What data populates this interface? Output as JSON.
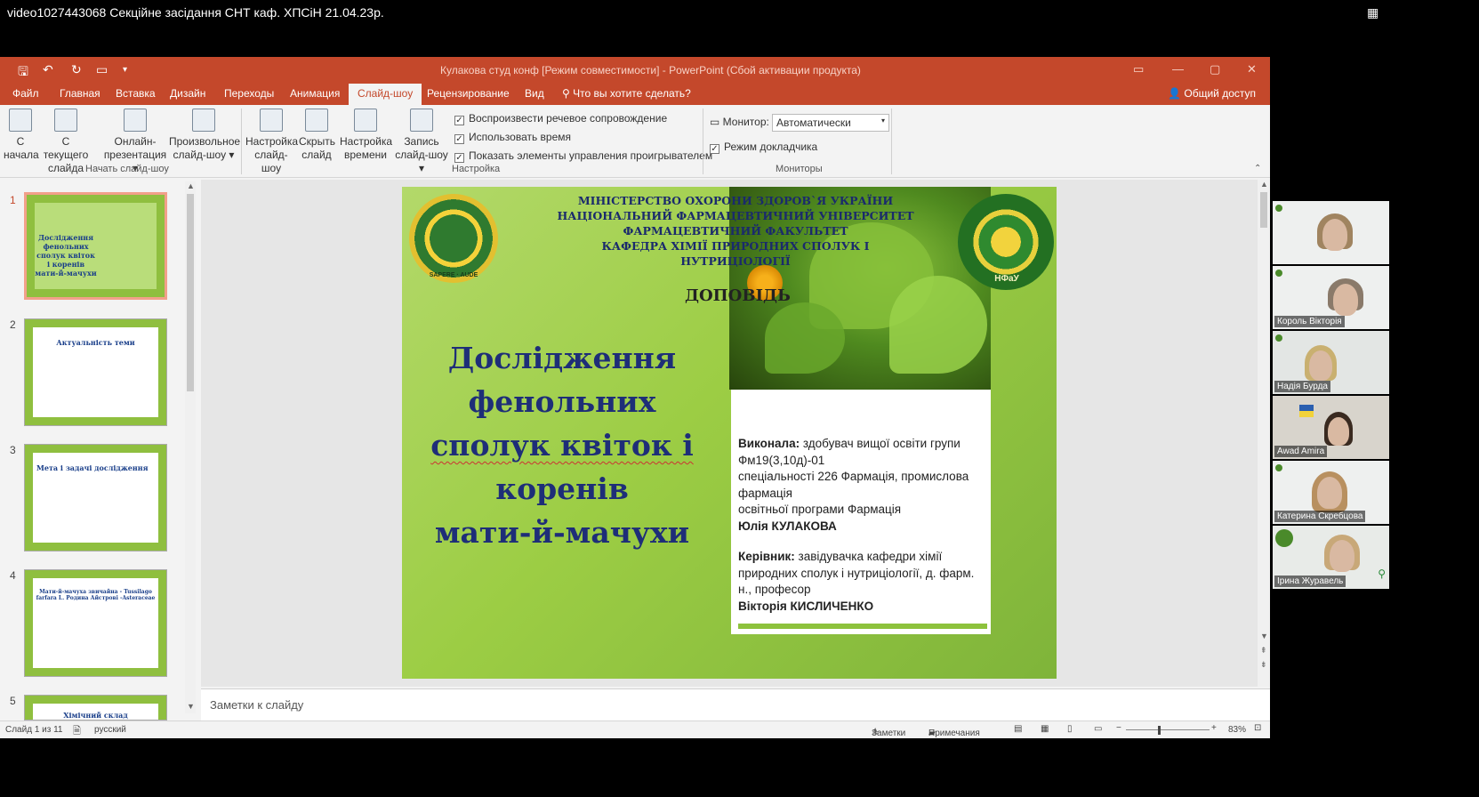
{
  "video_title": "video1027443068 Секційне засідання СНТ каф. ХПСіН 21.04.23р.",
  "window_title": "Кулакова студ конф [Режим совместимости] - PowerPoint (Сбой активации продукта)",
  "tabs": [
    "Файл",
    "Главная",
    "Вставка",
    "Дизайн",
    "Переходы",
    "Анимация",
    "Слайд-шоу",
    "Рецензирование",
    "Вид"
  ],
  "active_tab": "Слайд-шоу",
  "tell_me": "Что вы хотите сделать?",
  "share": "Общий доступ",
  "ribbon": {
    "from_start": [
      "С",
      "начала"
    ],
    "from_current": [
      "С текущего",
      "слайда"
    ],
    "online": [
      "Онлайн-",
      "презентация ▾"
    ],
    "custom": [
      "Произвольное",
      "слайд-шоу ▾"
    ],
    "group_start": "Начать слайд-шоу",
    "setup": [
      "Настройка",
      "слайд-шоу"
    ],
    "hide": [
      "Скрыть",
      "слайд"
    ],
    "rehearse": [
      "Настройка",
      "времени"
    ],
    "record": [
      "Запись",
      "слайд-шоу ▾"
    ],
    "chk_narration": "Воспроизвести речевое сопровождение",
    "chk_timings": "Использовать время",
    "chk_controls": "Показать элементы управления проигрывателем",
    "group_setup": "Настройка",
    "monitor_label": "Монитор:",
    "monitor_value": "Автоматически",
    "presenter_view": "Режим докладчика",
    "group_monitors": "Мониторы"
  },
  "thumbnails": [
    {
      "num": "1",
      "title": "Дослідження фенольних сполук квіток і коренів мати-й-мачухи"
    },
    {
      "num": "2",
      "title": "Актуальність теми"
    },
    {
      "num": "3",
      "title": "Мета і задачі дослідження"
    },
    {
      "num": "4",
      "title": "Мати-й-мачуха звичайна - Tussilago farfara L. Родина Айстрові -Asteraceae"
    },
    {
      "num": "5",
      "title": "Хімічний склад"
    }
  ],
  "slide": {
    "header": [
      "МІНІСТЕРСТВО ОХОРОНИ ЗДОРОВ`Я УКРАЇНИ",
      "НАЦІОНАЛЬНИЙ ФАРМАЦЕВТИЧНИЙ УНІВЕРСИТЕТ",
      "ФАРМАЦЕВТИЧНИЙ ФАКУЛЬТЕТ",
      "КАФЕДРА ХІМІЇ ПРИРОДНИХ СПОЛУК І НУТРИЦІОЛОГІЇ"
    ],
    "report_label": "ДОПОВІДЬ",
    "title": [
      "Дослідження",
      "фенольних",
      "сполук квіток і",
      "коренів",
      "мати-й-мачухи"
    ],
    "logo_left_text": "SAPERE · AUDE",
    "logo_right_text": "НФаУ",
    "performed_label": "Виконала:",
    "performed_text": " здобувач вищої освіти групи Фм19(3,10д)-01",
    "specialty": "спеціальності 226 Фармація, промислова фармація",
    "program": "освітньої програми Фармація",
    "student": "Юлія КУЛАКОВА",
    "supervisor_label": "Керівник:",
    "supervisor_text": " завідувачка кафедри хімії природних сполук і нутриціології, д. фарм. н., професор",
    "supervisor_name": "Вікторія КИСЛИЧЕНКО"
  },
  "notes_placeholder": "Заметки к слайду",
  "status": {
    "slide_count": "Слайд 1 из 11",
    "language": "русский",
    "notes": "Заметки",
    "comments": "Примечания",
    "zoom": "83%"
  },
  "participants": [
    {
      "name": ""
    },
    {
      "name": "Король Вікторія"
    },
    {
      "name": "Надія Бурда"
    },
    {
      "name": "Awad Amira"
    },
    {
      "name": "Катерина Скребцова"
    },
    {
      "name": "Ірина Журавель"
    }
  ],
  "colors": {
    "accent": "#c4482b",
    "slide_green": "#9ccd44",
    "title_blue": "#1e2e78"
  }
}
